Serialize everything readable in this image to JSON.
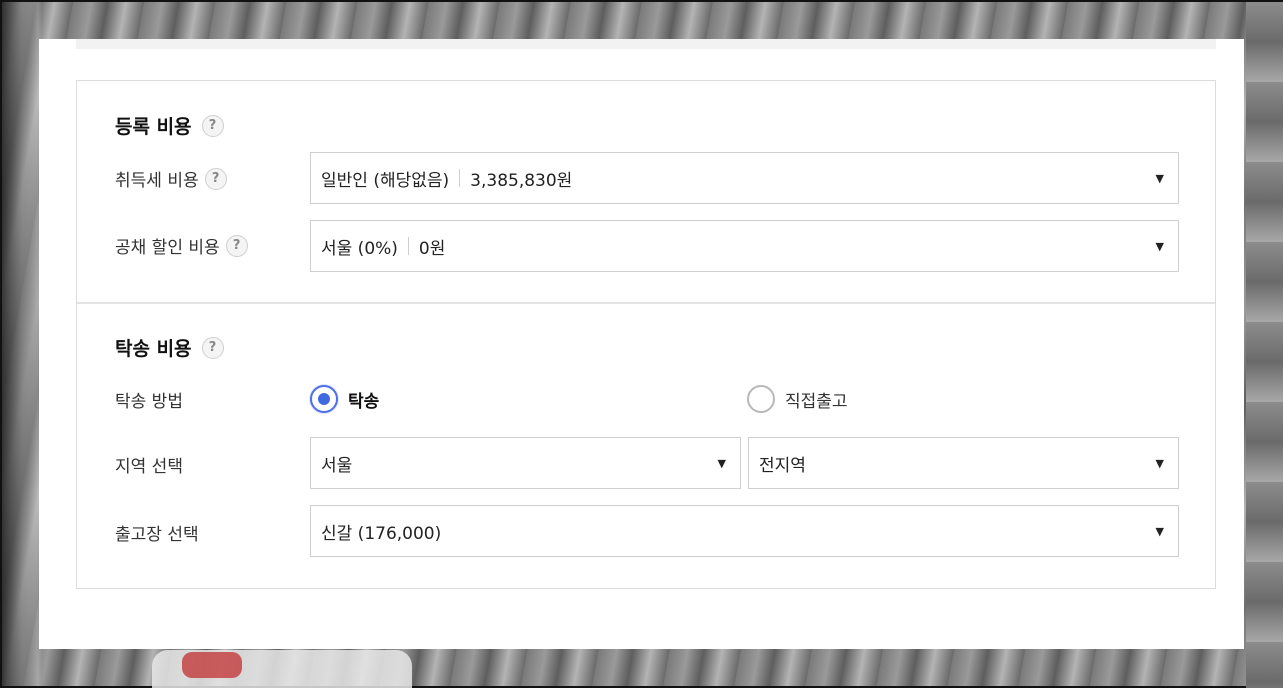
{
  "registration": {
    "title": "등록 비용",
    "help_icon": "?",
    "acquisition_tax": {
      "label": "취득세 비용",
      "selected": "일반인 (해당없음)",
      "amount": "3,385,830원"
    },
    "bond_discount": {
      "label": "공채 할인 비용",
      "selected": "서울 (0%)",
      "amount": "0원"
    }
  },
  "delivery": {
    "title": "탁송 비용",
    "help_icon": "?",
    "method": {
      "label": "탁송 방법",
      "options": [
        "탁송",
        "직접출고"
      ],
      "selected_index": 0
    },
    "region": {
      "label": "지역 선택",
      "selected": "서울",
      "sub_selected": "전지역"
    },
    "depot": {
      "label": "출고장 선택",
      "selected": "신갈 (176,000)"
    }
  },
  "caret": "▼",
  "colors": {
    "accent": "#4169e1",
    "border": "#cfcfcf"
  }
}
